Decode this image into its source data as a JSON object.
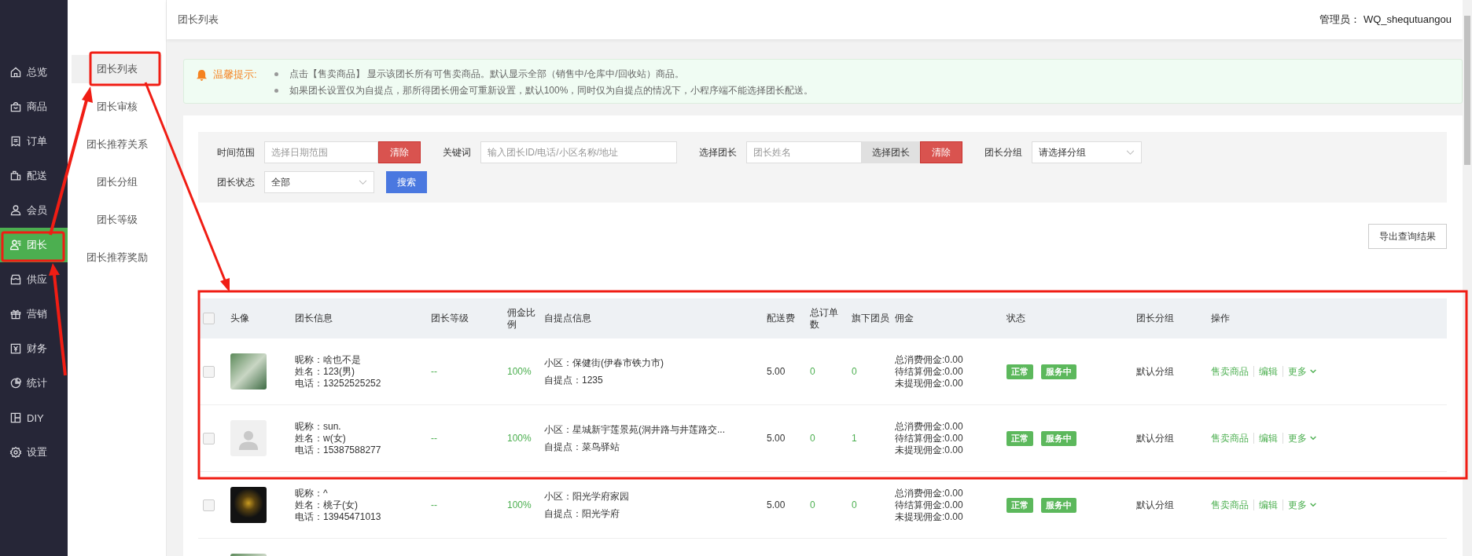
{
  "sidebar": {
    "items": [
      {
        "label": "总览",
        "selected": false
      },
      {
        "label": "商品",
        "selected": false
      },
      {
        "label": "订单",
        "selected": false
      },
      {
        "label": "配送",
        "selected": false
      },
      {
        "label": "会员",
        "selected": false
      },
      {
        "label": "团长",
        "selected": true
      },
      {
        "label": "供应",
        "selected": false
      },
      {
        "label": "营销",
        "selected": false
      },
      {
        "label": "财务",
        "selected": false
      },
      {
        "label": "统计",
        "selected": false
      },
      {
        "label": "DIY",
        "selected": false
      },
      {
        "label": "设置",
        "selected": false
      }
    ]
  },
  "submenu": {
    "items": [
      {
        "label": "团长列表",
        "selected": true
      },
      {
        "label": "团长审核",
        "selected": false
      },
      {
        "label": "团长推荐关系",
        "selected": false
      },
      {
        "label": "团长分组",
        "selected": false
      },
      {
        "label": "团长等级",
        "selected": false
      },
      {
        "label": "团长推荐奖励",
        "selected": false
      }
    ]
  },
  "header": {
    "title": "团长列表",
    "admin": "管理员： WQ_shequtuangou"
  },
  "notice": {
    "title": "温馨提示:",
    "items": [
      "点击【售卖商品】 显示该团长所有可售卖商品。默认显示全部（销售中/仓库中/回收站）商品。",
      "如果团长设置仅为自提点，那所得团长佣金可重新设置，默认100%，同时仅为自提点的情况下，小程序端不能选择团长配送。"
    ]
  },
  "filters": {
    "rows": [
      [
        {
          "kind": "input",
          "label": "时间范围",
          "placeholder": "选择日期范围",
          "buttons": [
            {
              "label": "清除",
              "kind": "danger"
            }
          ]
        },
        {
          "kind": "input",
          "label": "关键词",
          "placeholder": "输入团长ID/电话/小区名称/地址"
        },
        {
          "kind": "input",
          "label": "选择团长",
          "placeholder": "团长姓名",
          "buttons": [
            {
              "label": "选择团长",
              "kind": "grey"
            },
            {
              "label": "清除",
              "kind": "danger"
            }
          ]
        },
        {
          "kind": "select",
          "label": "团长分组",
          "value": "请选择分组"
        }
      ],
      [
        {
          "kind": "select",
          "label": "团长状态",
          "value": "全部"
        },
        {
          "kind": "button",
          "label": "搜索"
        }
      ]
    ]
  },
  "export_button": "导出查询结果",
  "table": {
    "header_checked": false,
    "columns": [
      "头像",
      "团长信息",
      "团长等级",
      "佣金比例",
      "自提点信息",
      "配送费",
      "总订单数",
      "旗下团员",
      "佣金",
      "状态",
      "团长分组",
      "操作"
    ],
    "rows": [
      {
        "checked": false,
        "avatar": {
          "kind": "photo"
        },
        "info": [
          "昵称：啥也不是",
          "姓名：123(男)",
          "电话：13252525252"
        ],
        "level": "--",
        "ratio": "100%",
        "pickup": [
          "小区：保健街(伊春市铁力市)",
          "自提点：1235"
        ],
        "fee": "5.00",
        "orders": "0",
        "members": "0",
        "commission": [
          "总消费佣金:0.00",
          "待结算佣金:0.00",
          "未提现佣金:0.00"
        ],
        "tags": [
          "正常",
          "服务中"
        ],
        "group": "默认分组",
        "actions": [
          {
            "label": "售卖商品",
            "kind": "link"
          },
          {
            "label": "编辑",
            "kind": "link"
          },
          {
            "label": "更多",
            "kind": "dropdown"
          }
        ]
      },
      {
        "checked": false,
        "avatar": {
          "kind": "default"
        },
        "info": [
          "昵称：sun.",
          "姓名：w(女)",
          "电话：15387588277"
        ],
        "level": "--",
        "ratio": "100%",
        "pickup": [
          "小区：星城新宇莲景苑(洞井路与井莲路交...",
          "自提点：菜鸟驿站"
        ],
        "fee": "5.00",
        "orders": "0",
        "members": "1",
        "commission": [
          "总消费佣金:0.00",
          "待结算佣金:0.00",
          "未提现佣金:0.00"
        ],
        "tags": [
          "正常",
          "服务中"
        ],
        "group": "默认分组",
        "actions": [
          {
            "label": "售卖商品",
            "kind": "link"
          },
          {
            "label": "编辑",
            "kind": "link"
          },
          {
            "label": "更多",
            "kind": "dropdown"
          }
        ]
      },
      {
        "checked": false,
        "avatar": {
          "kind": "photo-dark"
        },
        "info": [
          "昵称：^",
          "姓名：桃子(女)",
          "电话：13945471013"
        ],
        "level": "--",
        "ratio": "100%",
        "pickup": [
          "小区：阳光学府家园",
          "自提点：阳光学府"
        ],
        "fee": "5.00",
        "orders": "0",
        "members": "0",
        "commission": [
          "总消费佣金:0.00",
          "待结算佣金:0.00",
          "未提现佣金:0.00"
        ],
        "tags": [
          "正常",
          "服务中"
        ],
        "group": "默认分组",
        "actions": [
          {
            "label": "售卖商品",
            "kind": "link"
          },
          {
            "label": "编辑",
            "kind": "link"
          },
          {
            "label": "更多",
            "kind": "dropdown"
          }
        ]
      },
      {
        "avatar": {
          "kind": "photo"
        }
      }
    ]
  }
}
